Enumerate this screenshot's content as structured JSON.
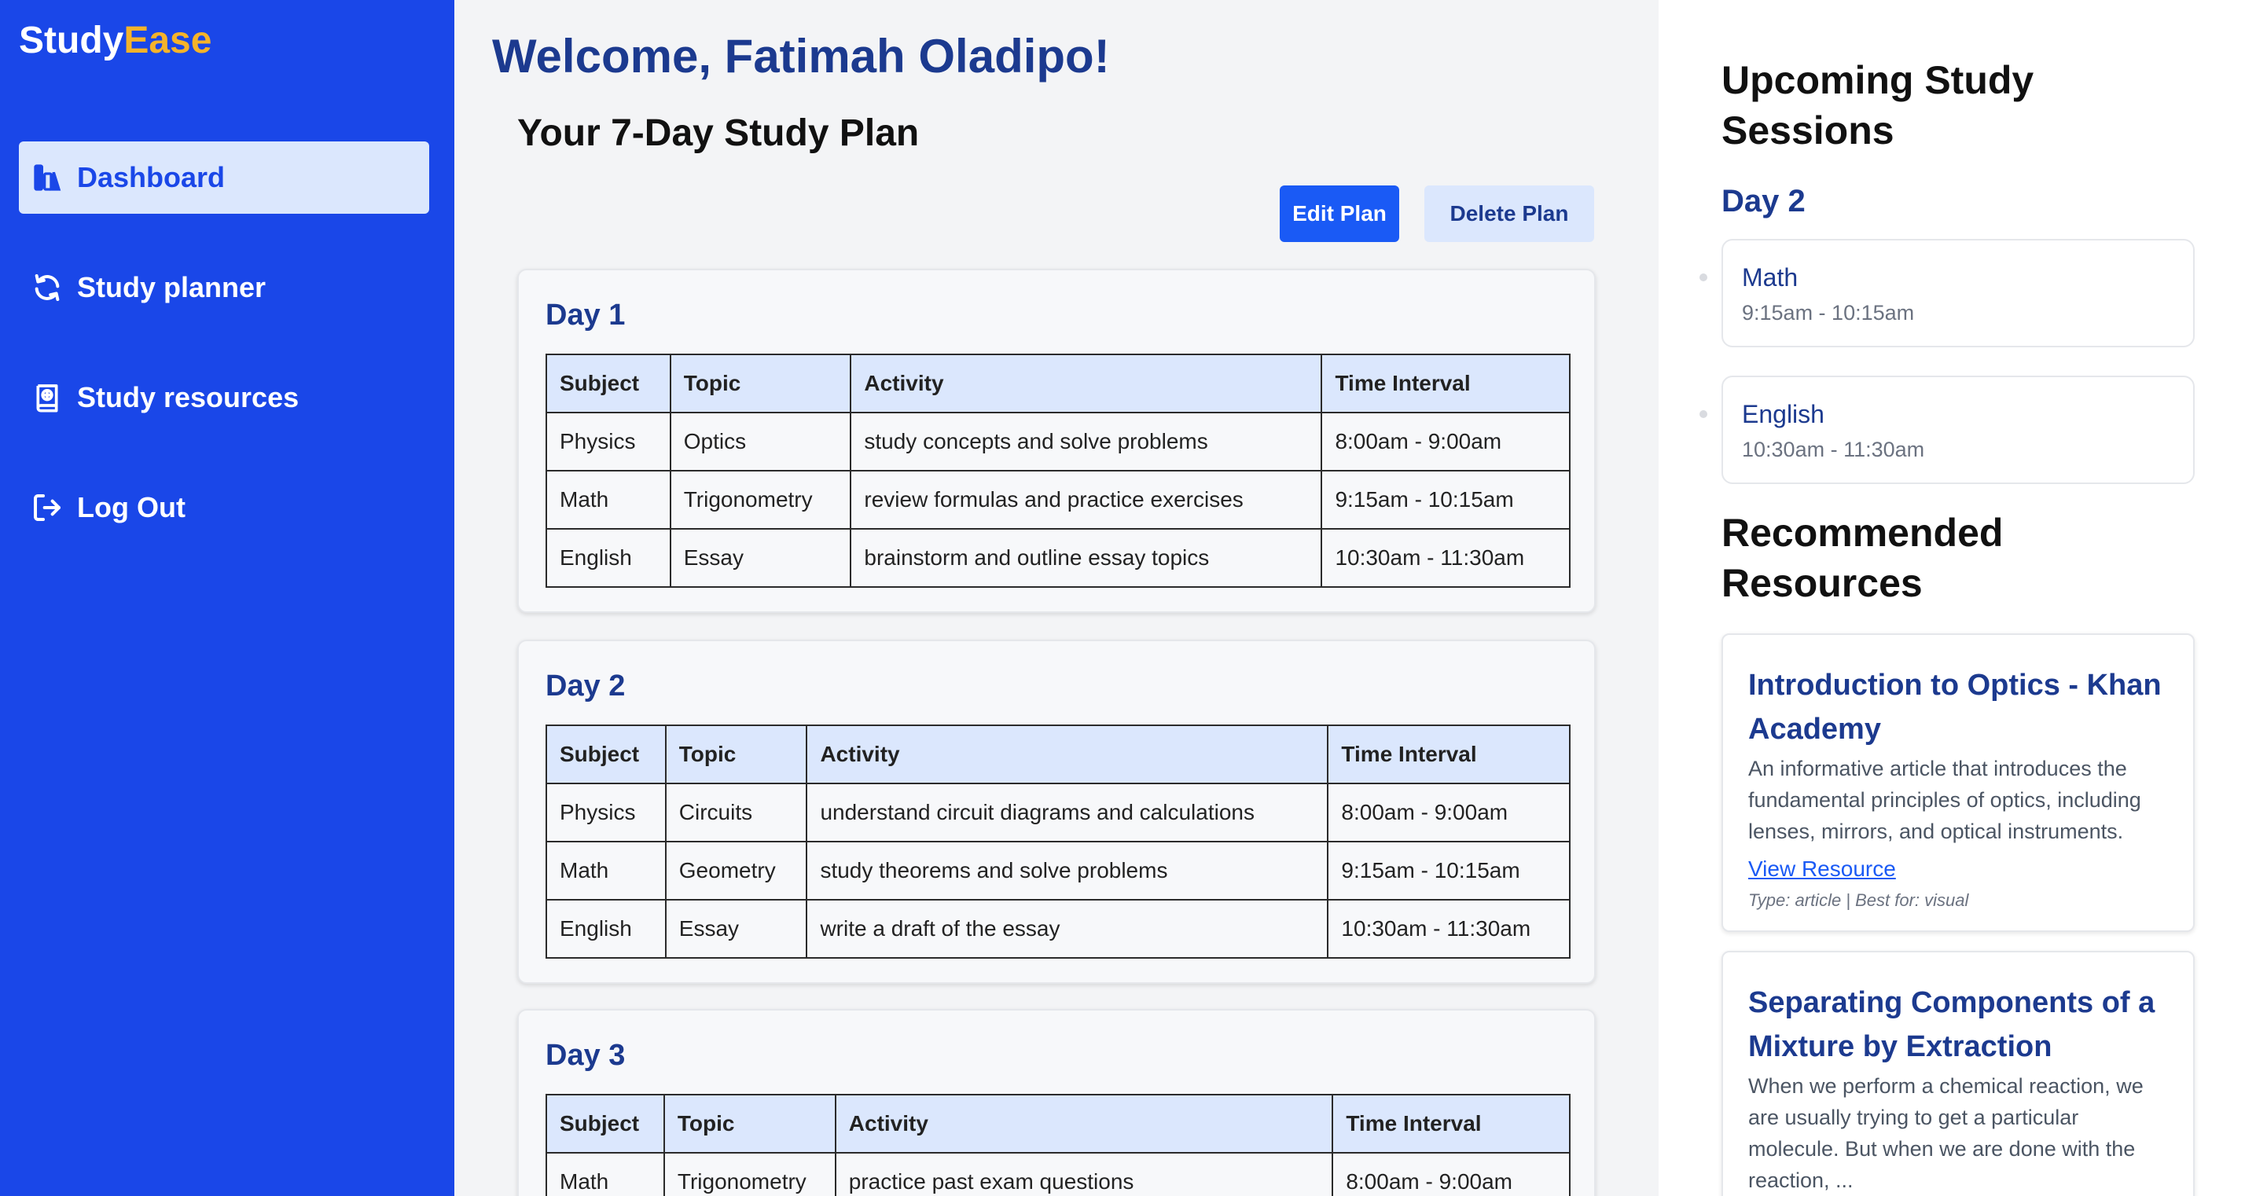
{
  "app": {
    "name_part1": "Study",
    "name_part2": "Ease",
    "brand_color": "#1a47e8",
    "accent_color": "#f5b32a"
  },
  "sidebar": {
    "items": [
      {
        "label": "Dashboard",
        "icon": "dashboard-icon",
        "active": true
      },
      {
        "label": "Study planner",
        "icon": "refresh-icon",
        "active": false
      },
      {
        "label": "Study resources",
        "icon": "book-icon",
        "active": false
      },
      {
        "label": "Log Out",
        "icon": "logout-icon",
        "active": false
      }
    ]
  },
  "main": {
    "welcome": "Welcome, Fatimah Oladipo!",
    "plan_title": "Your 7-Day Study Plan",
    "edit_label": "Edit Plan",
    "delete_label": "Delete Plan",
    "columns": [
      "Subject",
      "Topic",
      "Activity",
      "Time Interval"
    ],
    "days": [
      {
        "title": "Day 1",
        "rows": [
          [
            "Physics",
            "Optics",
            "study concepts and solve problems",
            "8:00am - 9:00am"
          ],
          [
            "Math",
            "Trigonometry",
            "review formulas and practice exercises",
            "9:15am - 10:15am"
          ],
          [
            "English",
            "Essay",
            "brainstorm and outline essay topics",
            "10:30am - 11:30am"
          ]
        ]
      },
      {
        "title": "Day 2",
        "rows": [
          [
            "Physics",
            "Circuits",
            "understand circuit diagrams and calculations",
            "8:00am - 9:00am"
          ],
          [
            "Math",
            "Geometry",
            "study theorems and solve problems",
            "9:15am - 10:15am"
          ],
          [
            "English",
            "Essay",
            "write a draft of the essay",
            "10:30am - 11:30am"
          ]
        ]
      },
      {
        "title": "Day 3",
        "rows": [
          [
            "Math",
            "Trigonometry",
            "practice past exam questions",
            "8:00am - 9:00am"
          ]
        ]
      }
    ]
  },
  "right": {
    "upcoming_title_line1": "Upcoming Study",
    "upcoming_title_line2": "Sessions",
    "session_day": "Day 2",
    "sessions": [
      {
        "subject": "Math",
        "time": "9:15am - 10:15am"
      },
      {
        "subject": "English",
        "time": "10:30am - 11:30am"
      }
    ],
    "recommended_title_line1": "Recommended",
    "recommended_title_line2": "Resources",
    "resources": [
      {
        "title": "Introduction to Optics - Khan Academy",
        "description": "An informative article that introduces the fundamental principles of optics, including lenses, mirrors, and optical instruments.",
        "link_label": "View Resource",
        "meta": "Type: article | Best for: visual"
      },
      {
        "title": "Separating Components of a Mixture by Extraction",
        "description": "When we perform a chemical reaction, we are usually trying to get a particular molecule. But when we are done with the reaction, ...",
        "link_label": "",
        "meta": ""
      }
    ]
  }
}
